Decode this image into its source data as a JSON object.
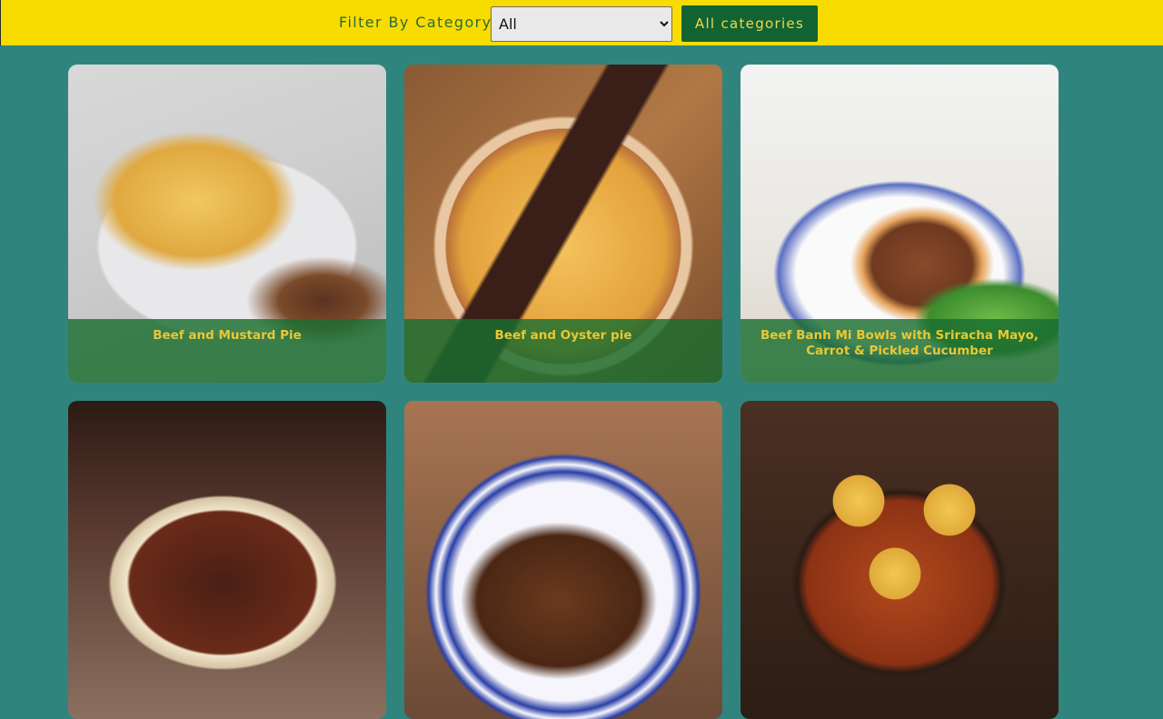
{
  "filter": {
    "label": "Filter By Category",
    "selected": "All",
    "button_label": "All categories"
  },
  "meals": [
    {
      "name": "Beef and Mustard Pie",
      "image": "pie1"
    },
    {
      "name": "Beef and Oyster pie",
      "image": "pie2"
    },
    {
      "name": "Beef Banh Mi Bowls with Sriracha Mayo, Carrot & Pickled Cucumber",
      "image": "bowl"
    },
    {
      "name": "",
      "image": "stew"
    },
    {
      "name": "",
      "image": "brisket"
    },
    {
      "name": "",
      "image": "dumpling"
    }
  ],
  "colors": {
    "header_bg": "#f8dc00",
    "page_bg": "#2f857e",
    "button_bg": "#126332",
    "caption_text": "#e9c834"
  }
}
